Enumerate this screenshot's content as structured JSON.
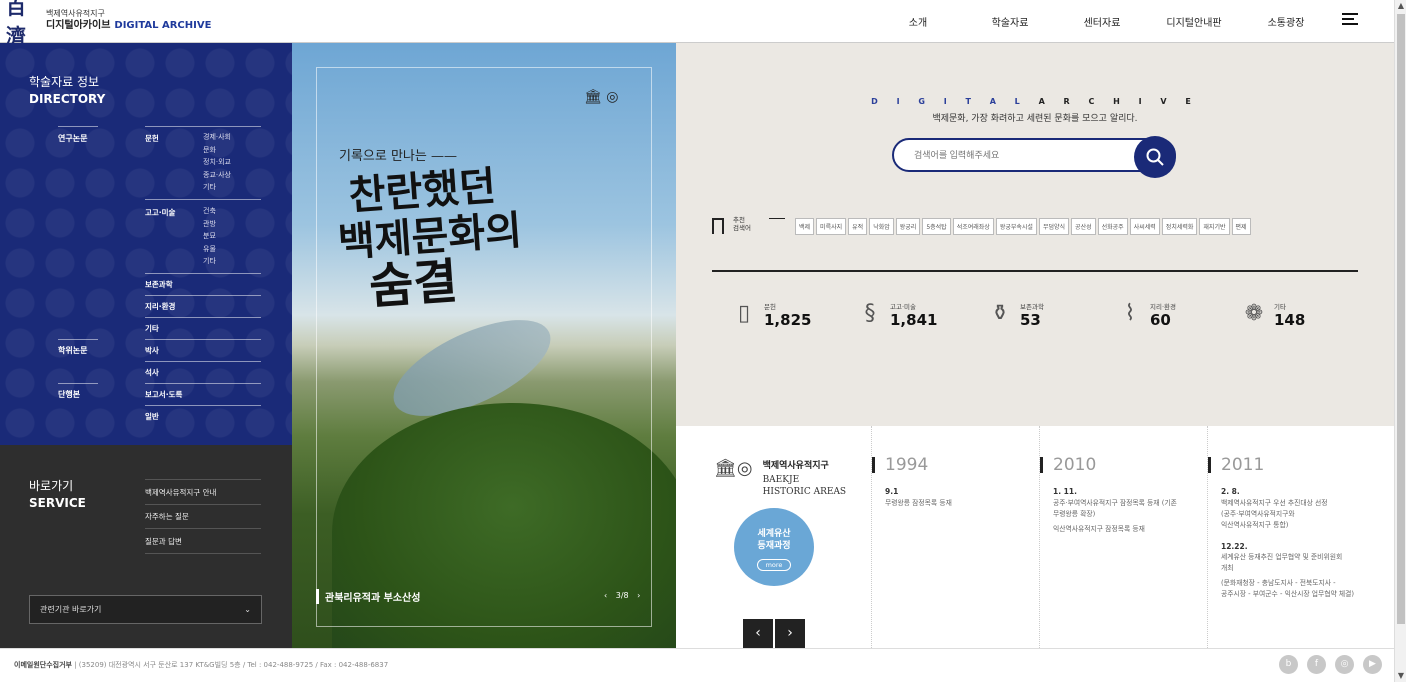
{
  "header": {
    "logo_mark": "百濟",
    "logo_sub": "백제역사유적지구",
    "logo_main": "디지털아카이브",
    "logo_main_en": "DIGITAL ARCHIVE",
    "nav": [
      "소개",
      "학술자료",
      "센터자료",
      "디지털안내판",
      "소통광장"
    ]
  },
  "directory": {
    "title_ko": "학술자료 정보",
    "title_en": "DIRECTORY",
    "groups": {
      "research": "연구논문",
      "degree": "학위논문",
      "book": "단행본"
    },
    "subs": {
      "literature": "문헌",
      "archaeology": "고고·미술",
      "conservation": "보존과학",
      "geography": "지리·환경",
      "etc": "기타",
      "doctor": "박사",
      "master": "석사",
      "report": "보고서·도록",
      "general": "일반"
    },
    "literature_leaves": [
      "경제·사회",
      "문화",
      "정치·외교",
      "종교·사상",
      "기타"
    ],
    "archaeology_leaves": [
      "건축",
      "관방",
      "분묘",
      "유물",
      "기타"
    ]
  },
  "service": {
    "title_ko": "바로가기",
    "title_en": "SERVICE",
    "links": [
      "백제역사유적지구 안내",
      "자주하는 질문",
      "질문과 답변"
    ],
    "select_label": "관련기관 바로가기"
  },
  "hero": {
    "kicker": "기록으로 만나는 ——",
    "headline_1": "찬란했던",
    "headline_2": "백제문화의",
    "headline_3": "숨결",
    "caption": "관북리유적과 부소산성",
    "pager": "3/8"
  },
  "search": {
    "title_a": "D I G I T A L",
    "title_b": "A R C H I V E",
    "subtitle": "백제문화, 가장 화려하고 세련된 문화를 모으고 알리다.",
    "placeholder": "검색어를 입력해주세요",
    "rec_label_1": "추천",
    "rec_label_2": "검색어",
    "tags": [
      "백제",
      "미륵사지",
      "유적",
      "낙화암",
      "왕궁리",
      "5층석탑",
      "석조여래좌상",
      "왕궁부속시설",
      "무덤양식",
      "공산성",
      "선화공주",
      "사씨세력",
      "정치세력화",
      "재지기반",
      "편제"
    ]
  },
  "stats": [
    {
      "label": "문헌",
      "value": "1,825",
      "icon": "book-icon"
    },
    {
      "label": "고고·미술",
      "value": "1,841",
      "icon": "dragon-icon"
    },
    {
      "label": "보존과학",
      "value": "53",
      "icon": "vessel-icon"
    },
    {
      "label": "지리·환경",
      "value": "60",
      "icon": "map-icon"
    },
    {
      "label": "기타",
      "value": "148",
      "icon": "tile-icon"
    }
  ],
  "timeline": {
    "whc_ko": "백제역사유적지구",
    "whc_en_1": "BAEKJE",
    "whc_en_2": "HISTORIC AREAS",
    "reg_btn_1": "세계유산",
    "reg_btn_2": "등재과정",
    "reg_btn_more": "more",
    "years": [
      {
        "year": "1994",
        "entries": [
          {
            "date": "9.1",
            "lines": [
              "무령왕릉 잠정목록 등재"
            ]
          }
        ]
      },
      {
        "year": "2010",
        "entries": [
          {
            "date": "1. 11.",
            "lines": [
              "공주·부여역사유적지구 잠정목록 등재 (기존",
              "무령왕릉 확장)",
              "익산역사유적지구 잠정목록 등재"
            ]
          }
        ]
      },
      {
        "year": "2011",
        "entries": [
          {
            "date": "2. 8.",
            "lines": [
              "백제역사유적지구 우선 추진대상 선정",
              "(공주·부여역사유적지구와",
              "익산역사유적지구 통합)"
            ]
          },
          {
            "date": "12.22.",
            "lines": [
              "세계유산 등재추진 업무협약 및 준비위원회",
              "개최",
              "(문화재청장 - 충남도지사 - 전북도지사 -",
              "공주시장 - 부여군수 - 익산시장 업무협약 체결)"
            ]
          }
        ]
      }
    ]
  },
  "footer": {
    "org": "이메일원단수집거부",
    "address": "(35209) 대전광역시 서구 둔산로 137 KT&G빌딩 5층 / Tel : 042-488-9725 / Fax : 042-488-6837"
  },
  "colors": {
    "navy": "#1a2a78",
    "dark": "#2e2e2e",
    "beige": "#ebe8e3",
    "sky": "#6aa7d6"
  }
}
